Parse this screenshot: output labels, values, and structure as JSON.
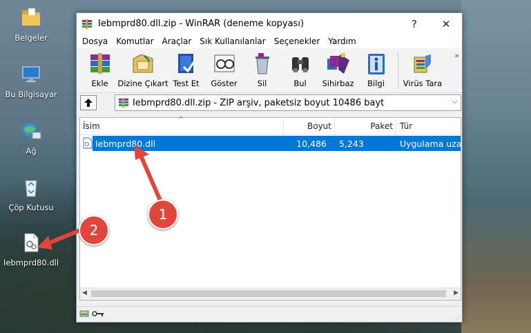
{
  "desktop": {
    "icons": [
      {
        "label": "Belgeler",
        "icon": "folder-icon"
      },
      {
        "label": "Bu Bilgisayar",
        "icon": "computer-icon"
      },
      {
        "label": "Ağ",
        "icon": "network-icon"
      },
      {
        "label": "Çöp Kutusu",
        "icon": "recycle-bin-icon"
      },
      {
        "label": "Iebmprd80.dll",
        "icon": "dll-file-icon"
      }
    ]
  },
  "window": {
    "title": "Iebmprd80.dll.zip - WinRAR (deneme kopyası)",
    "help_glyph": "?",
    "close_glyph": "✕",
    "colors": {
      "selection": "#0078d7",
      "badge": "#e0473c"
    }
  },
  "menu": [
    "Dosya",
    "Komutlar",
    "Araçlar",
    "Sık Kullanılanlar",
    "Seçenekler",
    "Yardım"
  ],
  "toolbar": {
    "buttons": [
      {
        "label": "Ekle",
        "icon": "add-archive-icon"
      },
      {
        "label": "Dizine Çıkart",
        "icon": "extract-icon"
      },
      {
        "label": "Test Et",
        "icon": "test-icon"
      },
      {
        "label": "Göster",
        "icon": "view-icon"
      },
      {
        "label": "Sil",
        "icon": "delete-icon"
      },
      {
        "label": "Bul",
        "icon": "find-icon"
      },
      {
        "label": "Sihirbaz",
        "icon": "wizard-icon"
      },
      {
        "label": "Bilgi",
        "icon": "info-icon"
      },
      {
        "label": "Virüs Tara",
        "icon": "virus-scan-icon"
      }
    ],
    "more_glyph": "»"
  },
  "address": {
    "text": "Iebmprd80.dll.zip - ZIP arşiv, paketsiz boyut 10486 bayt",
    "dropdown_glyph": "⌵"
  },
  "list": {
    "columns": [
      "İsim",
      "Boyut",
      "Paket",
      "Tür"
    ],
    "rows": [
      {
        "name": "Iebmprd80.dll",
        "size": "10,486",
        "packed": "5,243",
        "type": "Uygulama uza"
      }
    ]
  },
  "annotations": {
    "badge1": "1",
    "badge2": "2"
  }
}
